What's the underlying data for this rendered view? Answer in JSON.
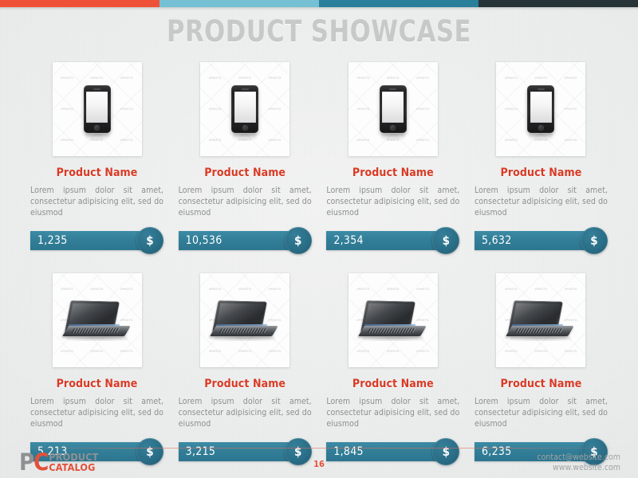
{
  "slide": {
    "title": "PRODUCT SHOWCASE",
    "background_color": "#eceeed"
  },
  "topbar": {
    "segments": [
      {
        "name": "red",
        "color": "#ef5138",
        "width_pct": 25
      },
      {
        "name": "light-blue",
        "color": "#76c0d4",
        "width_pct": 25
      },
      {
        "name": "teal",
        "color": "#2a7f9a",
        "width_pct": 25
      },
      {
        "name": "dark-slate",
        "color": "#263438",
        "width_pct": 25
      }
    ]
  },
  "products": [
    {
      "name": "Product Name",
      "description": "Lorem ipsum dolor sit amet, consectetur adipisicing elit, sed do eiusmod",
      "price": "1,235",
      "currency_symbol": "$",
      "image": "smartphone",
      "watermark": "#PHOTO"
    },
    {
      "name": "Product Name",
      "description": "Lorem ipsum dolor sit amet, consectetur adipisicing elit, sed do eiusmod",
      "price": "10,536",
      "currency_symbol": "$",
      "image": "smartphone",
      "watermark": "#PHOTO"
    },
    {
      "name": "Product Name",
      "description": "Lorem ipsum dolor sit amet, consectetur adipisicing elit, sed do eiusmod",
      "price": "2,354",
      "currency_symbol": "$",
      "image": "smartphone",
      "watermark": "#PHOTO"
    },
    {
      "name": "Product Name",
      "description": "Lorem ipsum dolor sit amet, consectetur adipisicing elit, sed do eiusmod",
      "price": "5,632",
      "currency_symbol": "$",
      "image": "smartphone",
      "watermark": "#PHOTO"
    },
    {
      "name": "Product Name",
      "description": "Lorem ipsum dolor sit amet, consectetur adipisicing elit, sed do eiusmod",
      "price": "5,213",
      "currency_symbol": "$",
      "image": "laptop",
      "watermark": "#PHOTO"
    },
    {
      "name": "Product Name",
      "description": "Lorem ipsum dolor sit amet, consectetur adipisicing elit, sed do eiusmod",
      "price": "3,215",
      "currency_symbol": "$",
      "image": "laptop",
      "watermark": "#PHOTO"
    },
    {
      "name": "Product Name",
      "description": "Lorem ipsum dolor sit amet, consectetur adipisicing elit, sed do eiusmod",
      "price": "1,845",
      "currency_symbol": "$",
      "image": "laptop",
      "watermark": "#PHOTO"
    },
    {
      "name": "Product Name",
      "description": "Lorem ipsum dolor sit amet, consectetur adipisicing elit, sed do eiusmod",
      "price": "6,235",
      "currency_symbol": "$",
      "image": "laptop",
      "watermark": "#PHOTO"
    }
  ],
  "footer": {
    "logo": {
      "letter_p": "P",
      "letter_c": "C",
      "word_top": "PRODUCT",
      "word_bottom": "CATALOG",
      "gray_color": "#8e9192",
      "red_color": "#e2503a"
    },
    "page_number": "16",
    "email": "contact@website.com",
    "website": "www.website.com"
  },
  "theme": {
    "accent_red": "#d93a25",
    "accent_teal": "#327e97",
    "badge_teal": "#2a6e87",
    "title_gray": "#c7c9c8",
    "body_gray": "#8d9090"
  }
}
